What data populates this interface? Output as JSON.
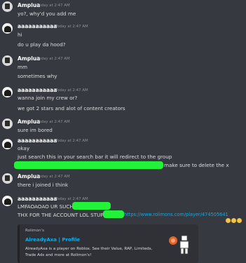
{
  "messages": [
    {
      "author": "Amplua",
      "time": "Today at 2:47 AM",
      "lines": [
        "yo?, why'd you add me"
      ]
    },
    {
      "author": "aaaaaaaaaaa",
      "time": "Today at 2:47 AM",
      "lines": [
        "hi",
        "do u play da hood?"
      ]
    },
    {
      "author": "Amplua",
      "time": "Today at 2:47 AM",
      "lines": [
        "mm",
        "sometimes why"
      ]
    },
    {
      "author": "aaaaaaaaaaa",
      "time": "Today at 2:47 AM",
      "lines": [
        "wanna join my crew or?",
        "we got 2 stars and alot of content creators"
      ]
    },
    {
      "author": "Amplua",
      "time": "Today at 2:47 AM",
      "lines": [
        "sure im bored"
      ]
    },
    {
      "author": "aaaaaaaaaaa",
      "time": "Today at 2:47 AM",
      "lines": [
        "okay",
        "just search this in your search bar it will redirect to the group",
        "make sure to delete the x"
      ]
    },
    {
      "author": "Amplua",
      "time": "Today at 2:47 AM",
      "lines": [
        "there i joined i think"
      ]
    },
    {
      "author": "aaaaaaaaaaa",
      "time": "Today at 2:47 AM",
      "lines": [
        "LMFAOAOAO UR SUCH",
        "THX FOR THE ACCOUNT LOL STUPID",
        "https://www.rolimons.com/player/474505641"
      ]
    }
  ],
  "embed": {
    "provider": "Rolimon's",
    "title": "AlreadyAxa | Profile",
    "description": "AlreadyAxa is a player on Roblox. See their Value, RAP, Limiteds, Trade Ads and more at Rolimon's!"
  },
  "colors": {
    "background": "#36393f",
    "redaction": "#22f23a",
    "link": "#00aff4"
  }
}
